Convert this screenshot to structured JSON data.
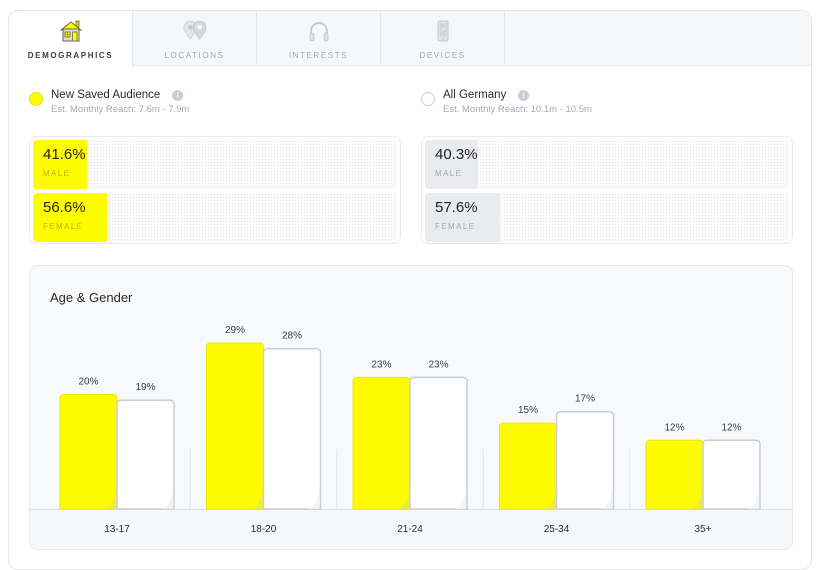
{
  "tabs": [
    {
      "label": "DEMOGRAPHICS",
      "icon": "house-icon",
      "active": true
    },
    {
      "label": "LOCATIONS",
      "icon": "map-pins-icon",
      "active": false
    },
    {
      "label": "INTERESTS",
      "icon": "headphones-icon",
      "active": false
    },
    {
      "label": "DEVICES",
      "icon": "phone-icon",
      "active": false
    }
  ],
  "audiences": [
    {
      "name": "New Saved Audience",
      "reach": "Est. Monthly Reach: 7.6m - 7.9m",
      "color": "#fffc00",
      "selected": true
    },
    {
      "name": "All Germany",
      "reach": "Est. Monthly Reach: 10.1m - 10.5m",
      "color": "#ffffff",
      "selected": false
    }
  ],
  "gender": [
    {
      "audience": "New Saved Audience",
      "rows": [
        {
          "pct_label": "41.6%",
          "value": 41.6,
          "label": "MALE"
        },
        {
          "pct_label": "56.6%",
          "value": 56.6,
          "label": "FEMALE"
        }
      ]
    },
    {
      "audience": "All Germany",
      "rows": [
        {
          "pct_label": "40.3%",
          "value": 40.3,
          "label": "MALE"
        },
        {
          "pct_label": "57.6%",
          "value": 57.6,
          "label": "FEMALE"
        }
      ]
    }
  ],
  "chart_data": {
    "type": "bar",
    "title": "Age & Gender",
    "xlabel": "",
    "ylabel": "",
    "categories": [
      "13-17",
      "18-20",
      "21-24",
      "25-34",
      "35+"
    ],
    "series": [
      {
        "name": "New Saved Audience",
        "color": "#fffc00",
        "values": [
          20,
          29,
          23,
          15,
          12
        ]
      },
      {
        "name": "All Germany",
        "color": "#ffffff",
        "values": [
          19,
          28,
          23,
          17,
          12
        ]
      }
    ],
    "value_suffix": "%",
    "ylim": [
      0,
      29
    ],
    "grid": false,
    "legend": "top"
  }
}
